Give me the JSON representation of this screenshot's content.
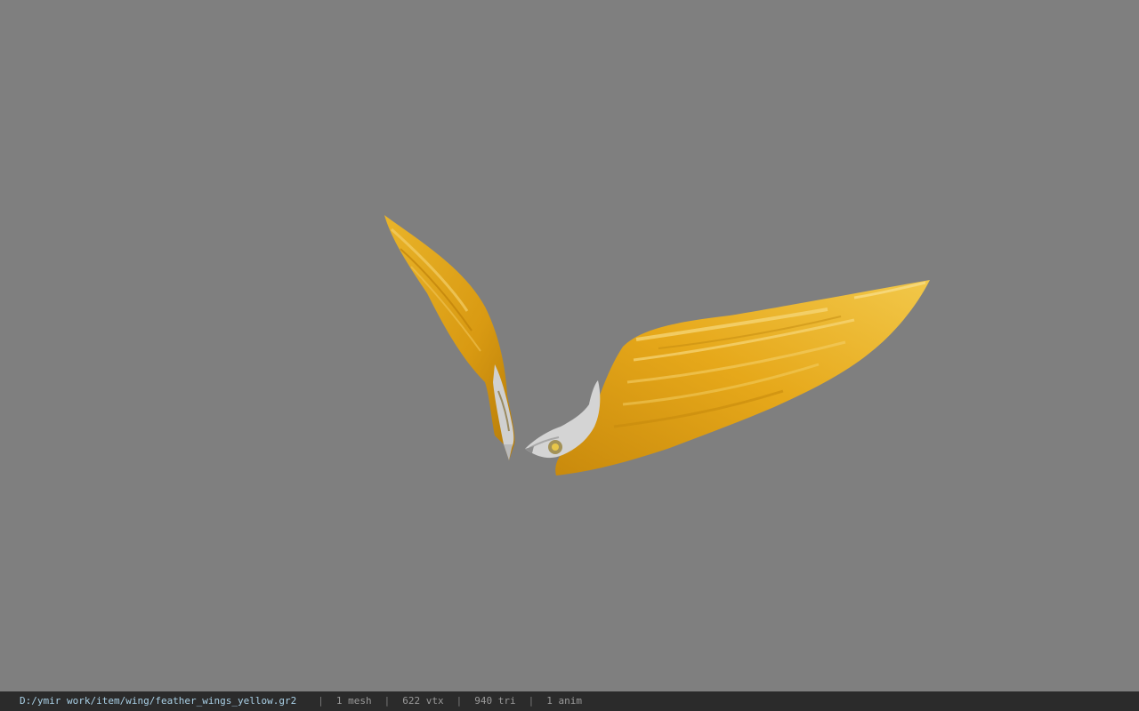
{
  "viewport": {
    "background_color": "#7f7f7f",
    "model": {
      "name": "feather wings yellow",
      "primary_color": "#e0a316",
      "highlight_color": "#f3d77a",
      "shadow_color": "#a56e08",
      "trim_color": "#cfcfcf"
    }
  },
  "status_bar": {
    "file_path": "D:/ymir work/item/wing/feather_wings_yellow.gr2",
    "separator": "|",
    "mesh_count": "1 mesh",
    "vertex_count": "622 vtx",
    "triangle_count": "940 tri",
    "animation_count": "1 anim",
    "path_color": "#a9d0e6",
    "background_color": "#2b2b2b"
  }
}
